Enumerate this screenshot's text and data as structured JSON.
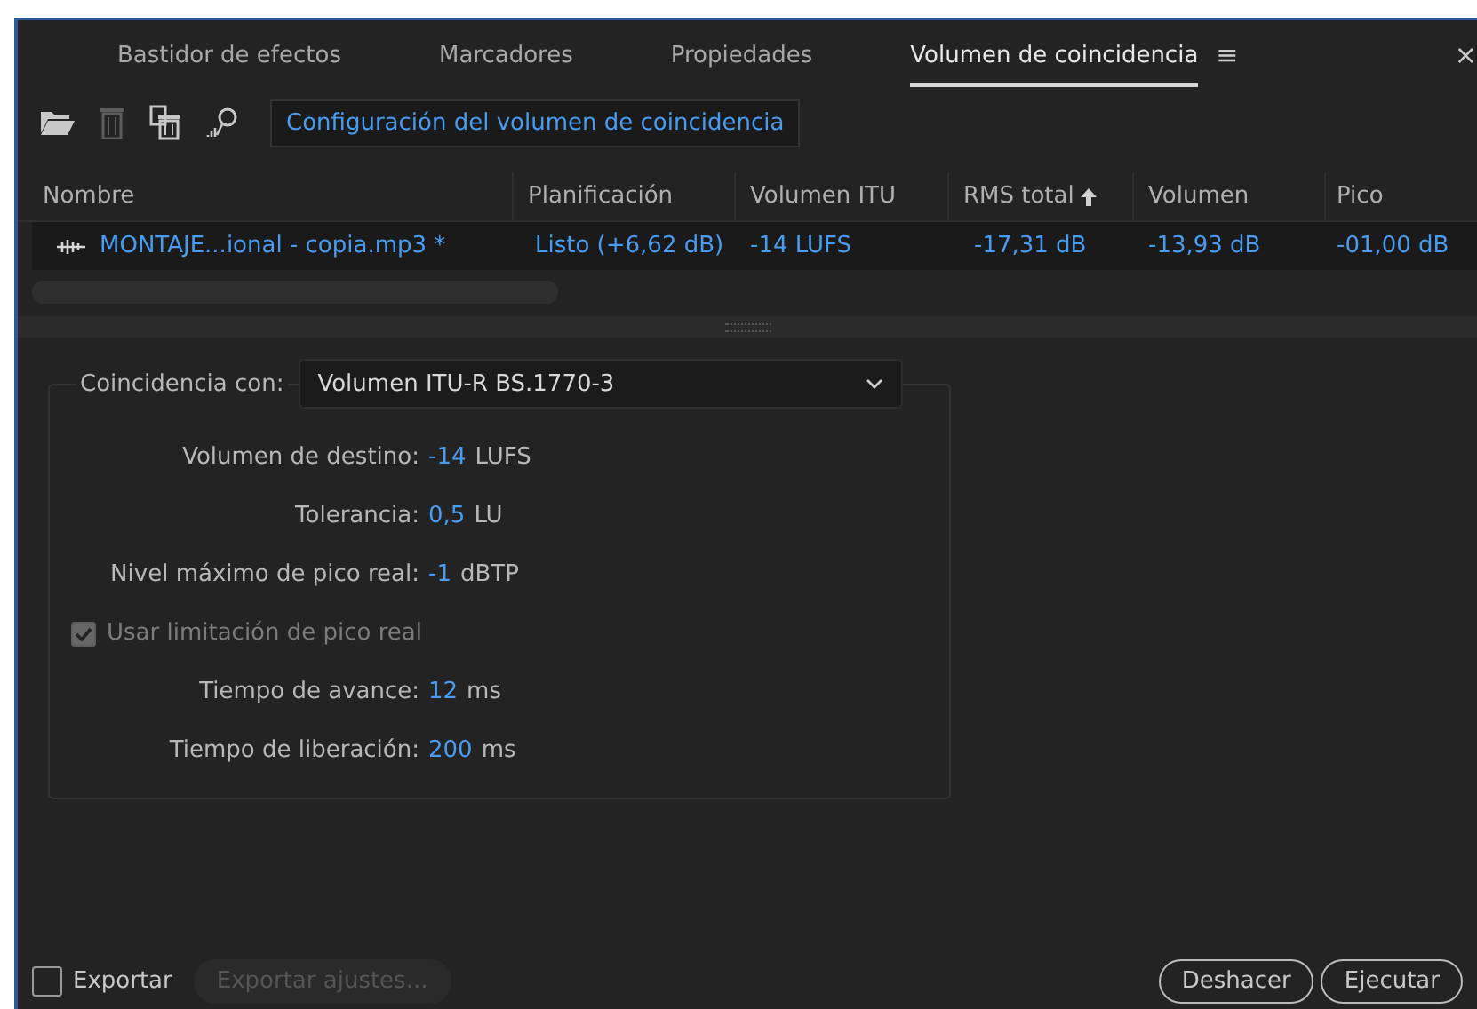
{
  "tabs": [
    {
      "label": "Bastidor de efectos",
      "selected": false
    },
    {
      "label": "Marcadores",
      "selected": false
    },
    {
      "label": "Propiedades",
      "selected": false
    },
    {
      "label": "Volumen de coincidencia",
      "selected": true
    }
  ],
  "panel_menu": "≡",
  "close": "×",
  "toolbar": {
    "open_disabled": false,
    "delete_disabled": true,
    "clear_disabled": false,
    "settings_button": "Configuración del volumen de coincidencia"
  },
  "table": {
    "columns": [
      {
        "label": "Nombre",
        "sorted": false
      },
      {
        "label": "Planificación",
        "sorted": false
      },
      {
        "label": "Volumen ITU",
        "sorted": false
      },
      {
        "label": "RMS total",
        "sorted": true
      },
      {
        "label": "Volumen",
        "sorted": false
      },
      {
        "label": "Pico",
        "sorted": false
      }
    ],
    "rows": [
      {
        "cells": [
          "MONTAJE...ional - copia.mp3 *",
          "Listo (+6,62 dB)",
          "-14 LUFS",
          "-17,31 dB",
          "-13,93 dB",
          "-01,00 dB"
        ]
      }
    ]
  },
  "settings": {
    "match_label": "Coincidencia con:",
    "match_value": "Volumen ITU-R BS.1770-3",
    "rows": [
      {
        "kind": "value",
        "label": "Volumen de destino:",
        "value": "-14",
        "unit": "LUFS"
      },
      {
        "kind": "value",
        "label": "Tolerancia:",
        "value": "0,5",
        "unit": "LU"
      },
      {
        "kind": "value",
        "label": "Nivel máximo de pico real:",
        "value": "-1",
        "unit": "dBTP"
      },
      {
        "kind": "checkbox",
        "label": "Usar limitación de pico real",
        "checked": true,
        "disabled": true
      },
      {
        "kind": "value",
        "label": "Tiempo de avance:",
        "value": "12",
        "unit": "ms"
      },
      {
        "kind": "value",
        "label": "Tiempo de liberación:",
        "value": "200",
        "unit": "ms"
      }
    ]
  },
  "footer": {
    "export": {
      "label": "Exportar",
      "checked": false
    },
    "export_settings": {
      "label": "Exportar ajustes...",
      "disabled": true
    },
    "buttons": [
      "Deshacer",
      "Ejecutar"
    ]
  }
}
